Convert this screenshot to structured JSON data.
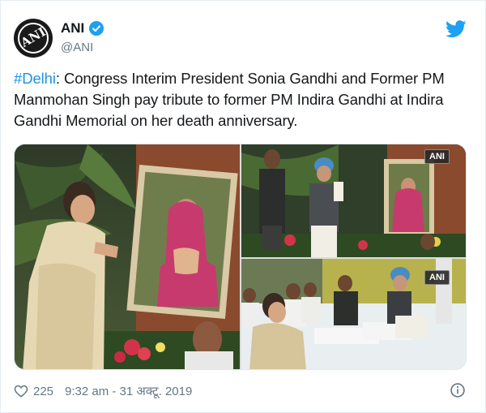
{
  "account": {
    "display_name": "ANI",
    "handle": "@ANI",
    "avatar_text": "ANI",
    "verified": true
  },
  "tweet": {
    "hashtag": "#Delhi",
    "body": ": Congress Interim President Sonia Gandhi and Former PM Manmohan Singh pay tribute to former PM Indira Gandhi at Indira Gandhi Memorial on her death anniversary."
  },
  "media": {
    "watermark_top_right": "ANI",
    "watermark_bottom_right": "ANI"
  },
  "footer": {
    "likes": "225",
    "timestamp": "9:32 am - 31 अक्टू. 2019"
  },
  "colors": {
    "link": "#1b95e0",
    "brand_blue": "#1da1f2",
    "secondary_text": "#657786"
  },
  "icons": {
    "verified": "verified-badge-icon",
    "brand": "twitter-bird-icon",
    "like": "heart-icon",
    "info": "info-icon"
  }
}
